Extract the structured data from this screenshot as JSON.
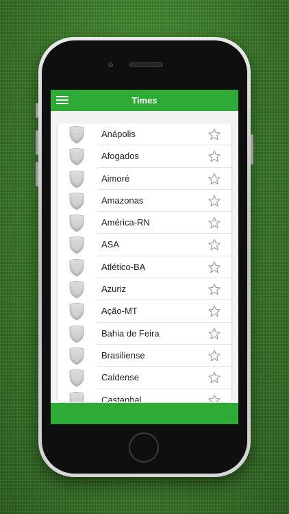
{
  "navbar": {
    "title": "Times"
  },
  "teams": [
    {
      "name": "Anápolis"
    },
    {
      "name": "Afogados"
    },
    {
      "name": "Aimoré"
    },
    {
      "name": "Amazonas"
    },
    {
      "name": "América-RN"
    },
    {
      "name": "ASA"
    },
    {
      "name": "Atlético-BA"
    },
    {
      "name": "Azuriz"
    },
    {
      "name": "Ação-MT"
    },
    {
      "name": "Bahia de Feira"
    },
    {
      "name": "Brasiliense"
    },
    {
      "name": "Caldense"
    },
    {
      "name": "Castanhal"
    }
  ],
  "icons": {
    "menu": "menu-icon",
    "badge": "team-shield-icon",
    "favorite": "star-outline-icon"
  },
  "colors": {
    "accent": "#2eaa37",
    "background": "#f2f2f2",
    "shield": "#c8c8c8",
    "star": "#9a9a9a"
  }
}
